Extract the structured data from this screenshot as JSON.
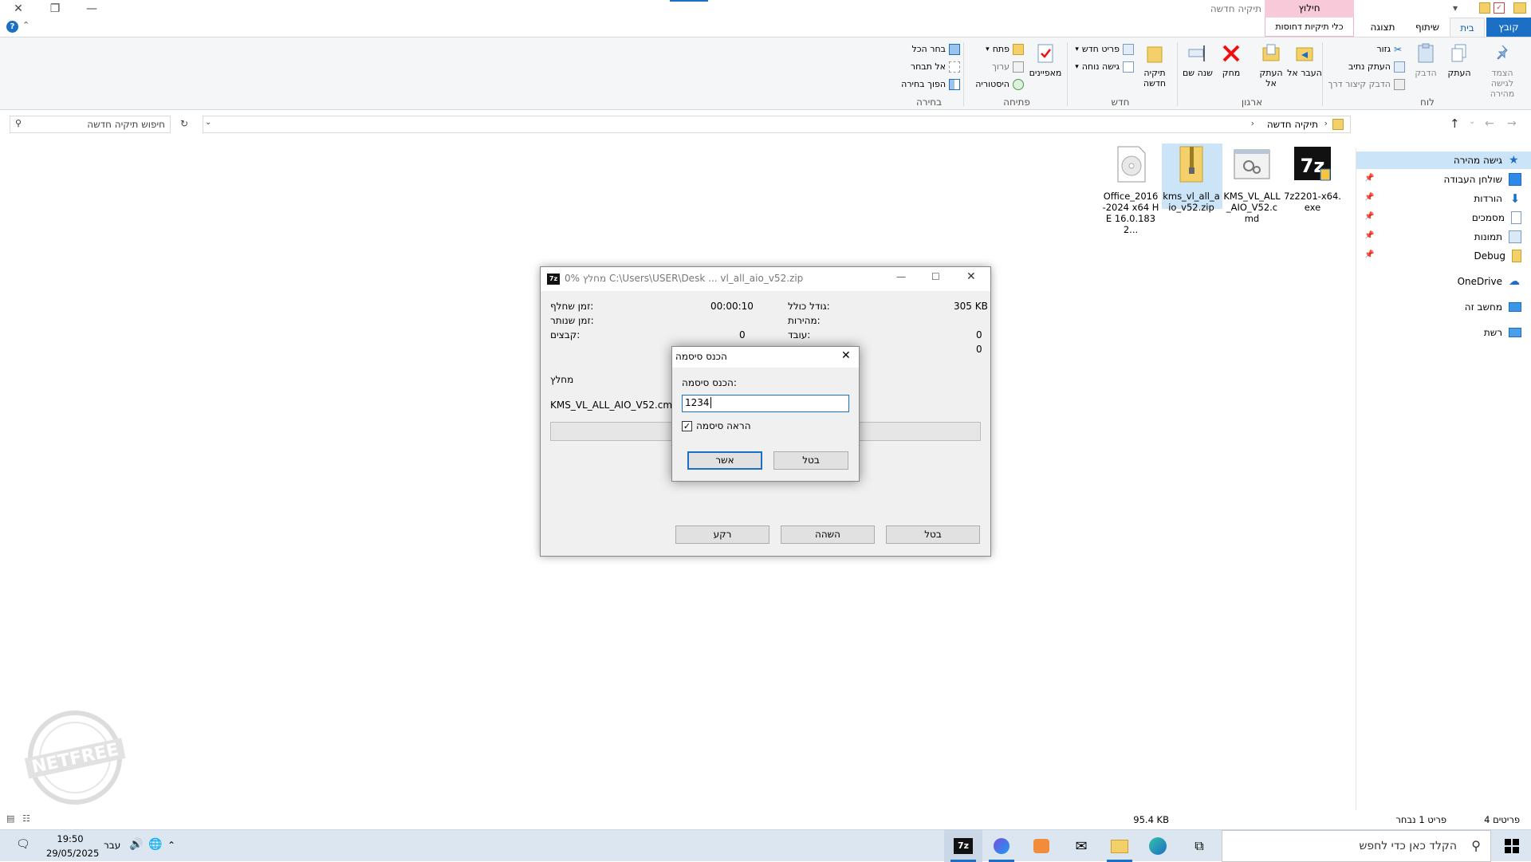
{
  "window": {
    "title": "תיקיה חדשה",
    "tools_header": "חילוץ",
    "tools_tab": "כלי תיקיות דחוסות"
  },
  "tabs": [
    "קובץ",
    "בית",
    "שיתוף",
    "תצוגה"
  ],
  "ribbon": {
    "clipboard": {
      "label": "לוח",
      "pin": "הצמד לגישה מהירה",
      "copy": "העתק",
      "paste": "הדבק",
      "cut": "גזור",
      "copy_path": "העתק נתיב",
      "paste_shortcut": "הדבק קיצור דרך"
    },
    "organize": {
      "label": "ארגון",
      "move_to": "העבר אל",
      "copy_to": "העתק אל",
      "delete": "מחק",
      "rename": "שנה שם"
    },
    "new": {
      "label": "חדש",
      "new_folder": "תיקיה חדשה",
      "new_item": "פריט חדש",
      "easy_access": "גישה נוחה"
    },
    "open": {
      "label": "פתיחה",
      "properties": "מאפיינים",
      "open": "פתח",
      "edit": "ערוך",
      "history": "היסטוריה"
    },
    "select": {
      "label": "בחירה",
      "select_all": "בחר הכל",
      "select_none": "אל תבחר",
      "invert": "הפוך בחירה"
    }
  },
  "address": {
    "path": "תיקיה חדשה",
    "search_placeholder": "חיפוש תיקיה חדשה"
  },
  "nav": {
    "quick_access": "גישה מהירה",
    "items": [
      "שולחן העבודה",
      "הורדות",
      "מסמכים",
      "תמונות",
      "Debug"
    ],
    "onedrive": "OneDrive",
    "this_pc": "מחשב זה",
    "network": "רשת"
  },
  "files": [
    {
      "name": "7z2201-x64.exe"
    },
    {
      "name": "KMS_VL_ALL_AIO_V52.cmd"
    },
    {
      "name": "kms_vl_all_aio_v52.zip"
    },
    {
      "name": "Office_2016-2024 x64 HE 16.0.1832..."
    }
  ],
  "status": {
    "items": "4 פריטים",
    "selected": "פריט 1 נבחר",
    "size": "95.4 KB"
  },
  "progress_dialog": {
    "title": "0% מחלץ C:\\Users\\USER\\Desk ... vl_all_aio_v52.zip",
    "elapsed_label": "זמן שחלף:",
    "elapsed_value": "00:00:10",
    "remaining_label": "זמן שנותר:",
    "files_label": "קבצים:",
    "files_value": "0",
    "total_size_label": "גודל כולל:",
    "total_size_value": "305 KB",
    "speed_label": "מהירות:",
    "processed_label": "עובד:",
    "processed_value": "0",
    "extra_value": "0",
    "operation": "מחלץ",
    "current_file": "KMS_VL_ALL_AIO_V52.cmd",
    "progress": 0,
    "background_btn": "רקע",
    "pause_btn": "השהה",
    "cancel_btn": "בטל"
  },
  "password_dialog": {
    "title": "הכנס סיסמה",
    "prompt": "הכנס סיסמה:",
    "value": "1234",
    "show_password": "הראה סיסמה",
    "show_checked": true,
    "ok": "אשר",
    "cancel": "בטל"
  },
  "taskbar": {
    "search_placeholder": "הקלד כאן כדי לחפש",
    "time": "19:50",
    "date": "29/05/2025",
    "lang": "עבר"
  },
  "watermark": "NETFREE",
  "colors": {
    "accent": "#1b6fc4",
    "tools_pink": "#f8c9d9",
    "taskbar": "#dbe6f1"
  }
}
